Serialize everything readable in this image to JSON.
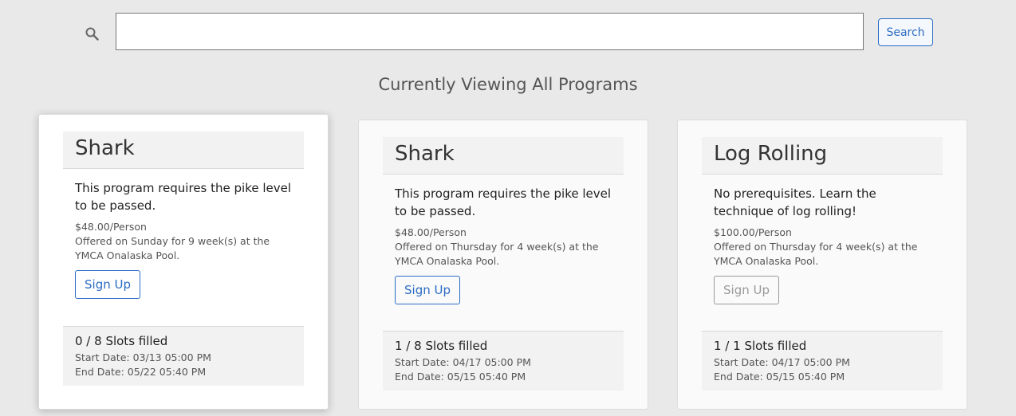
{
  "search": {
    "placeholder": "",
    "value": "",
    "button_label": "Search",
    "icon": "search-icon"
  },
  "page_title": "Currently Viewing All Programs",
  "colors": {
    "accent": "#2b6cc4",
    "background": "#e9e9e9",
    "disabled": "#999999"
  },
  "programs": [
    {
      "name": "Shark",
      "description": "This program requires the pike level to be passed.",
      "price": "$48.00/Person",
      "offered": "Offered on Sunday for 9 week(s) at the YMCA Onalaska Pool.",
      "signup_label": "Sign Up",
      "signup_enabled": true,
      "slots": "0 / 8 Slots filled",
      "start_date": "Start Date: 03/13 05:00 PM",
      "end_date": "End Date: 05/22 05:40 PM"
    },
    {
      "name": "Shark",
      "description": "This program requires the pike level to be passed.",
      "price": "$48.00/Person",
      "offered": "Offered on Thursday for 4 week(s) at the YMCA Onalaska Pool.",
      "signup_label": "Sign Up",
      "signup_enabled": true,
      "slots": "1 / 8 Slots filled",
      "start_date": "Start Date: 04/17 05:00 PM",
      "end_date": "End Date: 05/15 05:40 PM"
    },
    {
      "name": "Log Rolling",
      "description": "No prerequisites. Learn the technique of log rolling!",
      "price": "$100.00/Person",
      "offered": "Offered on Thursday for 4 week(s) at the YMCA Onalaska Pool.",
      "signup_label": "Sign Up",
      "signup_enabled": false,
      "slots": "1 / 1 Slots filled",
      "start_date": "Start Date: 04/17 05:00 PM",
      "end_date": "End Date: 05/15 05:40 PM"
    }
  ]
}
